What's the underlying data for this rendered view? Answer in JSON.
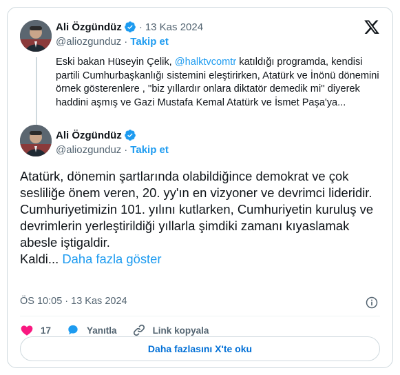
{
  "quoted": {
    "author_name": "Ali Özgündüz",
    "handle": "@aliozgunduz",
    "separator": "·",
    "date": "13 Kas 2024",
    "follow_label": "Takip et",
    "text_before": "Eski bakan Hüseyin Çelik, ",
    "mention": "@halktvcomtr",
    "text_after": "  katıldığı programda, kendisi partili Cumhurbaşkanlığı sistemini eleştirirken, Atatürk ve İnönü dönemini örnek gösterenlere , ''biz yıllardır onlara diktatör demedik mi'' diyerek haddini aşmış ve Gazi Mustafa Kemal Atatürk ve İsmet Paşa'ya..."
  },
  "main": {
    "author_name": "Ali Özgündüz",
    "handle": "@aliozgunduz",
    "separator": "·",
    "follow_label": "Takip et",
    "text": "Atatürk, dönemin şartlarında olabildiğince demokrat ve çok sesliliğe önem veren, 20. yy'ın en vizyoner ve devrimci lideridir.\nCumhuriyetimizin 101. yılını kutlarken, Cumhuriyetin kuruluş ve devrimlerin yerleştirildiği yıllarla şimdiki zamanı kıyaslamak abesle iştigaldir.\nKaldi... ",
    "show_more": "Daha fazla göster",
    "timestamp": "ÖS 10:05 · 13 Kas 2024"
  },
  "actions": {
    "like_count": "17",
    "reply_label": "Yanıtla",
    "copy_link_label": "Link kopyala"
  },
  "read_more_label": "Daha fazlasını X'te oku",
  "icons": {
    "brand": "x-logo-icon",
    "verified": "verified-badge-icon",
    "like": "heart-icon",
    "reply": "reply-bubble-icon",
    "link": "link-icon",
    "info": "info-icon"
  },
  "colors": {
    "accent": "#1d9bf0",
    "like": "#f91880",
    "text": "#0f1419",
    "muted": "#536471",
    "border": "#cfd9de"
  }
}
